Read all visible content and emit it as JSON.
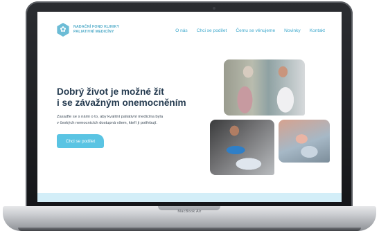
{
  "device": {
    "model_label": "MacBook Air"
  },
  "site": {
    "logo": {
      "icon": "hexagon-logo-icon",
      "line1": "NADAČNÍ FOND KLINIKY",
      "line2": "PALIATIVNÍ MEDICÍNY"
    },
    "nav": [
      {
        "label": "O nás"
      },
      {
        "label": "Chci se podílet"
      },
      {
        "label": "Čemu se věnujeme"
      },
      {
        "label": "Novinky"
      },
      {
        "label": "Kontakt"
      }
    ],
    "hero": {
      "title_line1": "Dobrý život je možné žít",
      "title_line2": "i se závažným onemocněním",
      "text_line1": "Zasaďte se s námi o to, aby kvalitní paliativní medicína byla",
      "text_line2": "v českých nemocnicích dostupná všem, kteří ji potřebují.",
      "cta_label": "Chci se podílet"
    },
    "colors": {
      "accent": "#5ac4e3",
      "nav_link": "#3ba7cc",
      "heading": "#243a4f",
      "footer_band": "#d3eef8"
    }
  }
}
